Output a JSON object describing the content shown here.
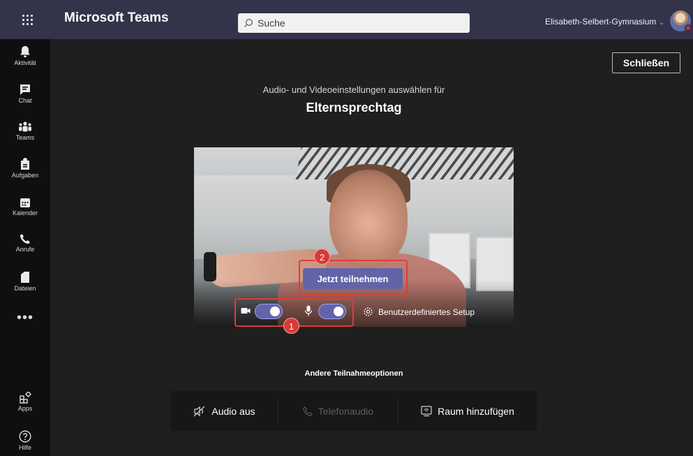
{
  "topbar": {
    "app_title": "Microsoft Teams",
    "search_placeholder": "Suche",
    "organization": "Elisabeth-Selbert-Gymnasium",
    "org_chevron": "⌄"
  },
  "rail": {
    "items": [
      {
        "label": "Aktivität",
        "icon": "bell-icon"
      },
      {
        "label": "Chat",
        "icon": "chat-icon"
      },
      {
        "label": "Teams",
        "icon": "teams-icon"
      },
      {
        "label": "Aufgaben",
        "icon": "assignments-icon"
      },
      {
        "label": "Kalender",
        "icon": "calendar-icon"
      },
      {
        "label": "Anrufe",
        "icon": "phone-icon"
      },
      {
        "label": "Dateien",
        "icon": "file-icon"
      }
    ],
    "more": "•••",
    "apps_label": "Apps",
    "help_label": "Hilfe"
  },
  "main": {
    "close_label": "Schließen",
    "subtitle": "Audio- und Videoeinstellungen auswählen für",
    "meeting_title": "Elternsprechtag",
    "join_label": "Jetzt teilnehmen",
    "custom_setup_label": "Benutzerdefiniertes Setup",
    "camera_on": true,
    "mic_on": true
  },
  "annotations": {
    "marker_1": "1",
    "marker_2": "2",
    "color": "#d83b34"
  },
  "other_options": {
    "heading": "Andere Teilnahmeoptionen",
    "audio_off": "Audio aus",
    "phone_audio": "Telefonaudio",
    "add_room": "Raum hinzufügen"
  },
  "colors": {
    "accent": "#6264a7",
    "topbar": "#33344a",
    "rail": "#0f0f0f",
    "background": "#1f1f1f"
  }
}
